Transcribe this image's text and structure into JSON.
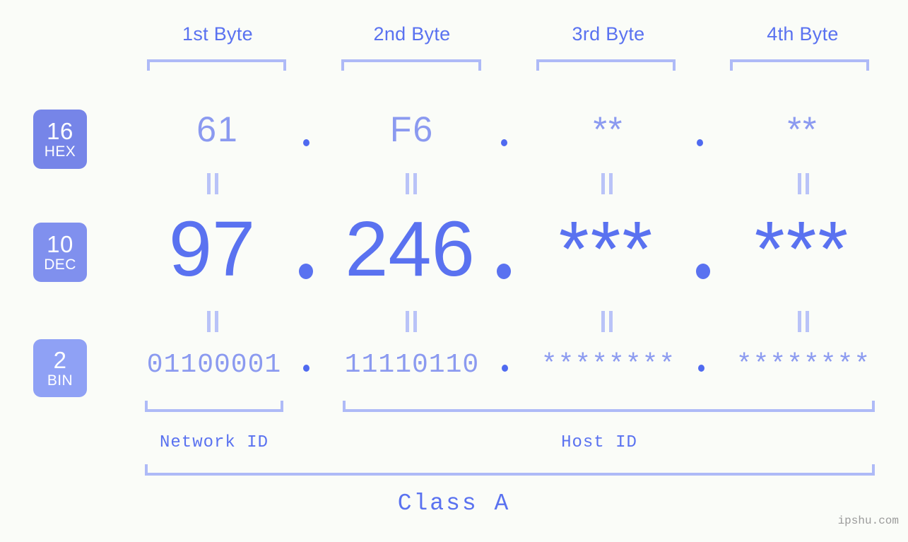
{
  "background_color": "#fafcf8",
  "accent_color": "#5a72f0",
  "light_accent_color": "#8b9af0",
  "bracket_color": "#aebaf7",
  "byte_headers": [
    {
      "label": "1st Byte"
    },
    {
      "label": "2nd Byte"
    },
    {
      "label": "3rd Byte"
    },
    {
      "label": "4th Byte"
    }
  ],
  "rows": {
    "hex": {
      "base_number": "16",
      "base_name": "HEX",
      "values": [
        "61",
        "F6",
        "**",
        "**"
      ],
      "separator": "."
    },
    "dec": {
      "base_number": "10",
      "base_name": "DEC",
      "values": [
        "97",
        "246",
        "***",
        "***"
      ],
      "separator": "."
    },
    "bin": {
      "base_number": "2",
      "base_name": "BIN",
      "values": [
        "01100001",
        "11110110",
        "********",
        "********"
      ],
      "separator": "."
    }
  },
  "equals_symbol": "=",
  "id_labels": {
    "network": "Network ID",
    "host": "Host ID"
  },
  "class_label": "Class A",
  "watermark": "ipshu.com"
}
